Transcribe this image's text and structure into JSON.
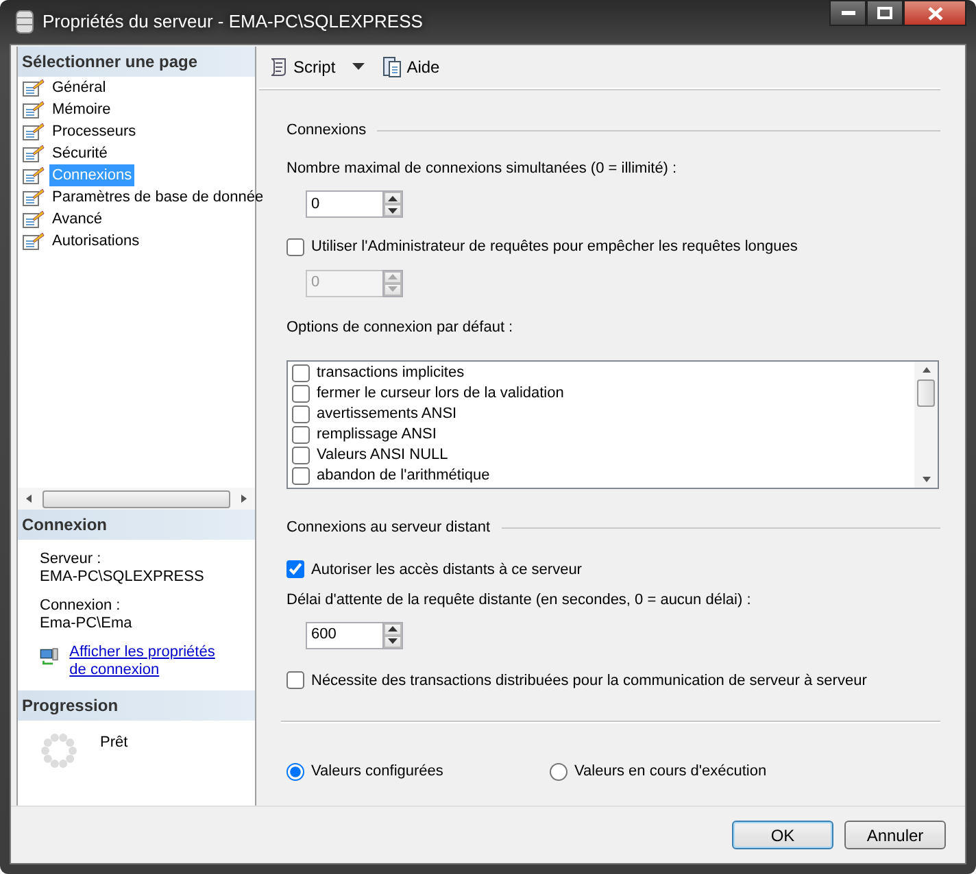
{
  "window": {
    "title": "Propriétés du serveur - EMA-PC\\SQLEXPRESS"
  },
  "sidebar": {
    "heading": "Sélectionner une page",
    "items": [
      {
        "label": "Général",
        "selected": false
      },
      {
        "label": "Mémoire",
        "selected": false
      },
      {
        "label": "Processeurs",
        "selected": false
      },
      {
        "label": "Sécurité",
        "selected": false
      },
      {
        "label": "Connexions",
        "selected": true
      },
      {
        "label": "Paramètres de base de donnée",
        "selected": false
      },
      {
        "label": "Avancé",
        "selected": false
      },
      {
        "label": "Autorisations",
        "selected": false
      }
    ]
  },
  "connection_panel": {
    "heading": "Connexion",
    "server_label": "Serveur :",
    "server": "EMA-PC\\SQLEXPRESS",
    "login_label": "Connexion :",
    "login": "Ema-PC\\Ema",
    "link": "Afficher les propriétés de connexion"
  },
  "progress_panel": {
    "heading": "Progression",
    "status": "Prêt"
  },
  "toolbar": [
    {
      "label": "Script",
      "kind": "script"
    },
    {
      "label": "Aide",
      "kind": "help"
    }
  ],
  "connections": {
    "heading": "Connexions",
    "max_label": "Nombre maximal de connexions simultanées (0 = illimité) :",
    "max_value": {
      "value": "0",
      "disabled": false
    },
    "governor": {
      "label": "Utiliser l'Administrateur de requêtes pour empêcher les requêtes longues",
      "checked": false
    },
    "governor_value": {
      "value": "0",
      "disabled": true
    },
    "options_label": "Options de connexion par défaut :",
    "options": [
      {
        "label": "transactions implicites",
        "checked": false
      },
      {
        "label": "fermer le curseur lors de la validation",
        "checked": false
      },
      {
        "label": "avertissements ANSI",
        "checked": false
      },
      {
        "label": "remplissage ANSI",
        "checked": false
      },
      {
        "label": "Valeurs ANSI NULL",
        "checked": false
      },
      {
        "label": "abandon de l'arithmétique",
        "checked": false
      }
    ]
  },
  "remote": {
    "heading": "Connexions au serveur distant",
    "allow": {
      "label": "Autoriser les accès distants à ce serveur",
      "checked": true
    },
    "timeout_label": "Délai d'attente de la requête distante (en secondes, 0 = aucun délai) :",
    "timeout_value": {
      "value": "600",
      "disabled": false
    },
    "distributed": {
      "label": "Nécessite des transactions distribuées pour la communication de serveur à serveur",
      "checked": false
    }
  },
  "config_mode": [
    {
      "label": "Valeurs configurées",
      "selected": true
    },
    {
      "label": "Valeurs en cours d'exécution",
      "selected": false
    }
  ],
  "buttons": [
    {
      "label": "OK",
      "default": true
    },
    {
      "label": "Annuler",
      "default": false
    }
  ]
}
